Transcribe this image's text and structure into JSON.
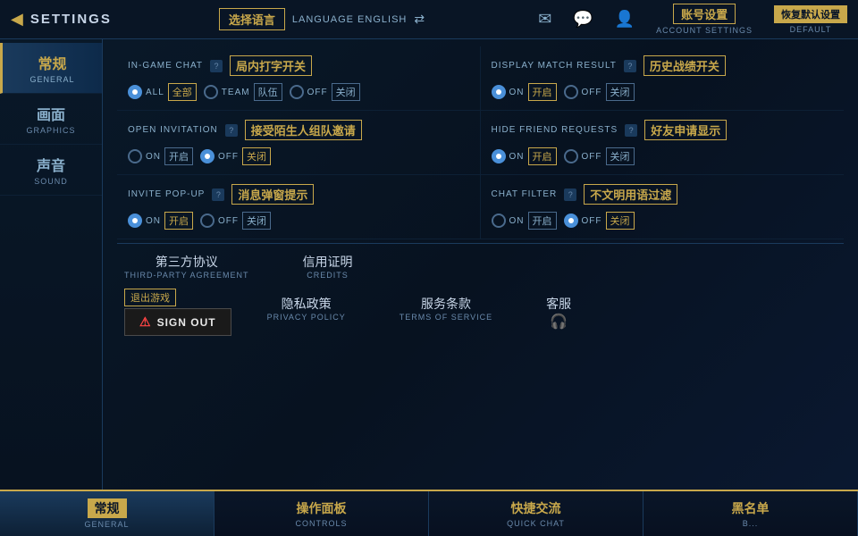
{
  "header": {
    "back_label": "◀",
    "title": "SETTINGS",
    "icons": [
      "envelope-icon",
      "chat-icon",
      "profile-icon"
    ]
  },
  "top_bar": {
    "language_zh": "选择语言",
    "language_en": "LANGUAGE ENGLISH",
    "language_arrows": "⇄",
    "account_zh": "账号设置",
    "account_en": "ACCOUNT SETTINGS",
    "restore_zh": "恢复默认设置",
    "restore_en": "DEFAULT"
  },
  "sidebar": {
    "items": [
      {
        "zh": "常规",
        "en": "GENERAL",
        "active": true
      },
      {
        "zh": "画面",
        "en": "GRAPHICS",
        "active": false
      },
      {
        "zh": "声音",
        "en": "SOUND",
        "active": false
      }
    ]
  },
  "settings": {
    "rows": [
      {
        "left": {
          "label_en": "IN-GAME CHAT",
          "label_zh": "局内打字开关",
          "info": "?",
          "options": [
            "ALL",
            "TEAM",
            "OFF"
          ],
          "options_zh": [
            "全部",
            "队伍",
            "关闭"
          ],
          "selected": 0
        },
        "right": {
          "label_en": "DISPLAY MATCH RESULT",
          "label_zh": "历史战绩开关",
          "info": "?",
          "options": [
            "ON",
            "OFF"
          ],
          "options_zh": [
            "开启",
            "关闭"
          ],
          "selected": 0
        }
      },
      {
        "left": {
          "label_en": "OPEN INVITATION",
          "label_zh": "接受陌生人组队邀请",
          "info": "?",
          "options": [
            "ON",
            "OFF"
          ],
          "options_zh": [
            "开启",
            "关闭"
          ],
          "selected": 1
        },
        "right": {
          "label_en": "HIDE FRIEND REQUESTS",
          "label_zh": "好友申请显示",
          "info": "?",
          "options": [
            "ON",
            "OFF"
          ],
          "options_zh": [
            "开启",
            "关闭"
          ],
          "selected": 0
        }
      },
      {
        "left": {
          "label_en": "INVITE POP-UP",
          "label_zh": "消息弹窗提示",
          "info": "?",
          "options": [
            "ON",
            "OFF"
          ],
          "options_zh": [
            "开启",
            "关闭"
          ],
          "selected": 0
        },
        "right": {
          "label_en": "CHAT FILTER",
          "label_zh": "不文明用语过滤",
          "info": "?",
          "options": [
            "ON",
            "OFF"
          ],
          "options_zh": [
            "开启",
            "关闭"
          ],
          "selected": 1
        }
      }
    ]
  },
  "bottom_links": {
    "third_party_zh": "第三方协议",
    "third_party_en": "THIRD-PARTY AGREEMENT",
    "credits_zh": "信用证明",
    "credits_en": "CREDITS",
    "signout_zh": "退出游戏",
    "signout_en": "SIGN OUT",
    "warning_icon": "⚠",
    "privacy_zh": "隐私政策",
    "privacy_en": "PRIVACY POLICY",
    "terms_zh": "服务条款",
    "terms_en": "TERMS OF SERVICE",
    "support_zh": "客服",
    "support_icon": "🎧"
  },
  "bottom_nav": {
    "items": [
      {
        "zh": "常规",
        "en": "GENERAL",
        "active": true
      },
      {
        "zh": "操作面板",
        "en": "CONTROLS",
        "active": false
      },
      {
        "zh": "快捷交流",
        "en": "QUICK CHAT",
        "active": false
      },
      {
        "zh": "黑名单",
        "en": "B...",
        "active": false
      }
    ]
  }
}
